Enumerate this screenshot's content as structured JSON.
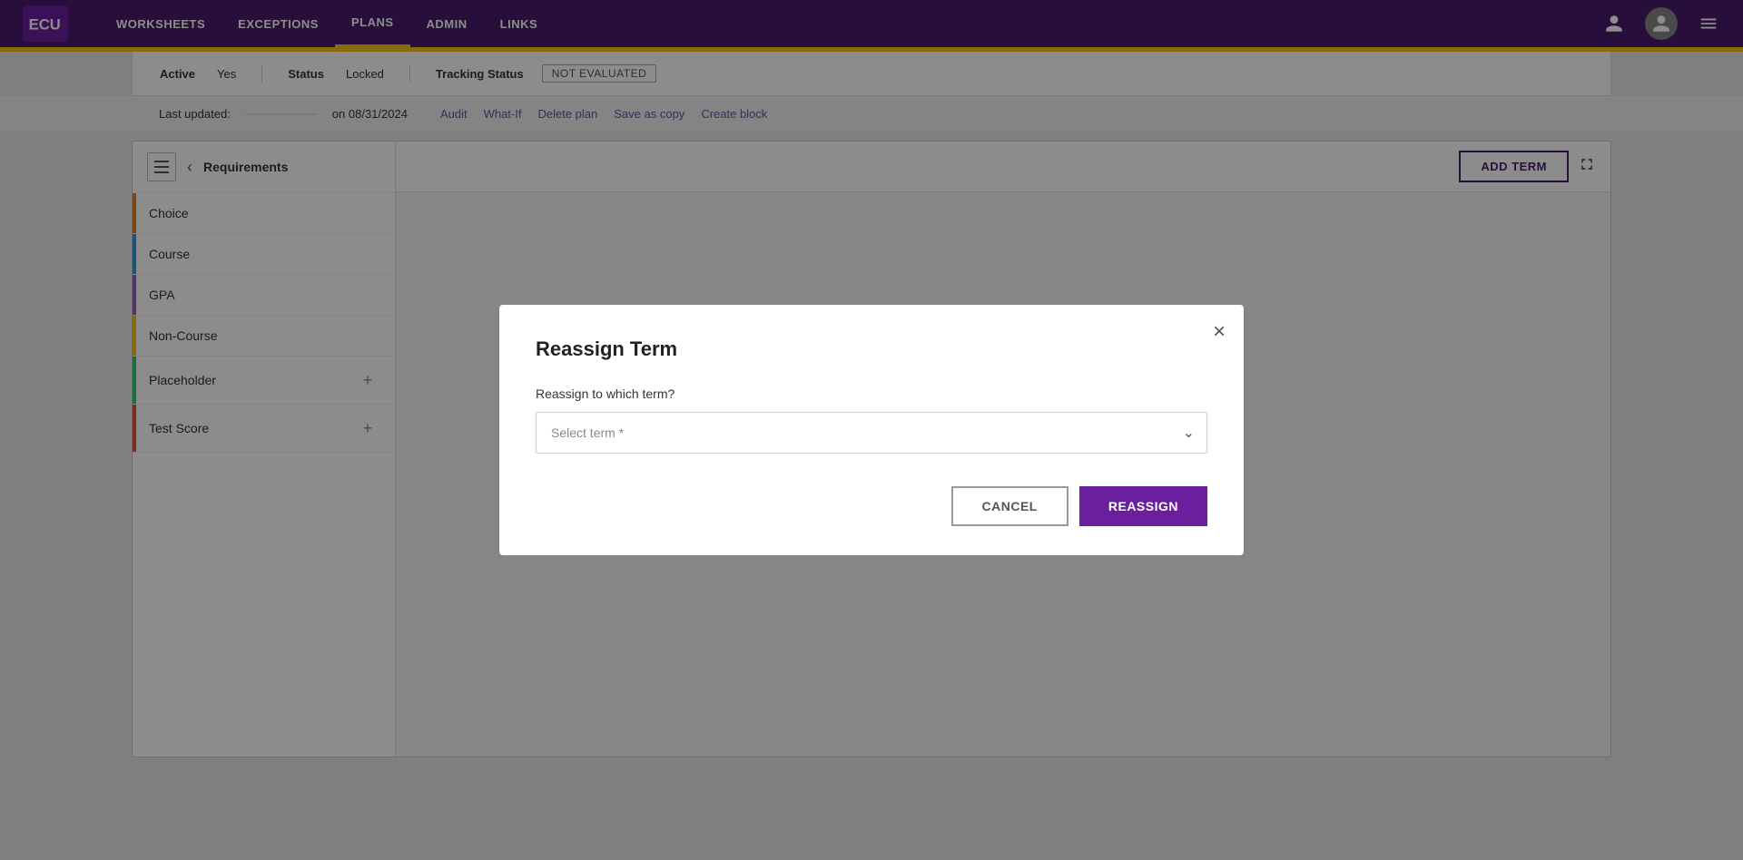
{
  "nav": {
    "links": [
      {
        "label": "WORKSHEETS",
        "active": false
      },
      {
        "label": "EXCEPTIONS",
        "active": false
      },
      {
        "label": "PLANS",
        "active": true
      },
      {
        "label": "ADMIN",
        "active": false
      },
      {
        "label": "LINKS",
        "active": false
      }
    ]
  },
  "info_bar": {
    "active_label": "Active",
    "active_value": "Yes",
    "status_label": "Status",
    "status_value": "Locked",
    "tracking_label": "Tracking Status",
    "tracking_badge": "NOT EVALUATED"
  },
  "last_updated": {
    "label": "Last updated:",
    "name": "",
    "on_text": "on 08/31/2024"
  },
  "actions": [
    {
      "label": "Audit"
    },
    {
      "label": "What-If"
    },
    {
      "label": "Delete plan"
    },
    {
      "label": "Save as copy"
    },
    {
      "label": "Create block"
    }
  ],
  "sidebar": {
    "title": "Requirements",
    "items": [
      {
        "label": "Choice",
        "color": "#e67e22",
        "has_add": false
      },
      {
        "label": "Course",
        "color": "#3498db",
        "has_add": false
      },
      {
        "label": "GPA",
        "color": "#9b59b6",
        "has_add": false
      },
      {
        "label": "Non-Course",
        "color": "#f1c40f",
        "has_add": false
      },
      {
        "label": "Placeholder",
        "color": "#2ecc71",
        "has_add": true
      },
      {
        "label": "Test Score",
        "color": "#e74c3c",
        "has_add": true
      }
    ]
  },
  "toolbar": {
    "add_term_label": "ADD TERM"
  },
  "modal": {
    "title": "Reassign Term",
    "close_label": "×",
    "question": "Reassign to which term?",
    "select_placeholder": "Select term *",
    "cancel_label": "CANCEL",
    "reassign_label": "REASSIGN"
  }
}
